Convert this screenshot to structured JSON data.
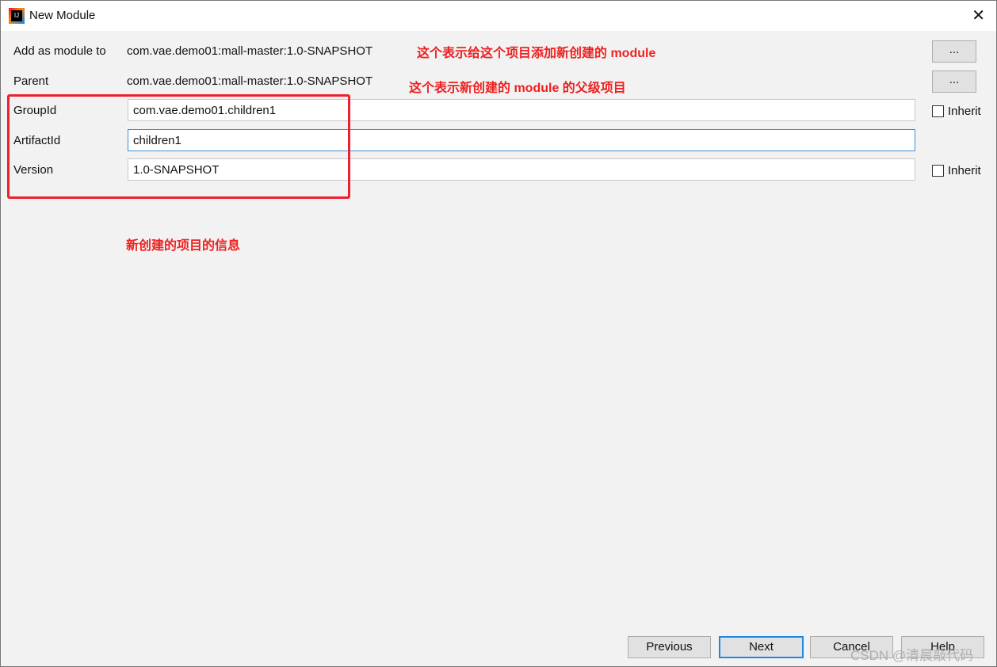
{
  "window": {
    "title": "New Module",
    "close": "✕"
  },
  "form": {
    "add_as_module_label": "Add as module to",
    "add_as_module_value": "com.vae.demo01:mall-master:1.0-SNAPSHOT",
    "parent_label": "Parent",
    "parent_value": "com.vae.demo01:mall-master:1.0-SNAPSHOT",
    "browse": "...",
    "groupid_label": "GroupId",
    "groupid_value": "com.vae.demo01.children1",
    "artifactid_label": "ArtifactId",
    "artifactid_value": "children1",
    "version_label": "Version",
    "version_value": "1.0-SNAPSHOT",
    "inherit": "Inherit"
  },
  "annotations": {
    "note1": "这个表示给这个项目添加新创建的 module",
    "note2": "这个表示新创建的 module 的父级项目",
    "note3": "新创建的项目的信息",
    "highlight_color": "#ee2030"
  },
  "buttons": {
    "previous": "Previous",
    "next": "Next",
    "cancel": "Cancel",
    "help": "Help"
  },
  "watermark": "CSDN @清晨敲代码"
}
